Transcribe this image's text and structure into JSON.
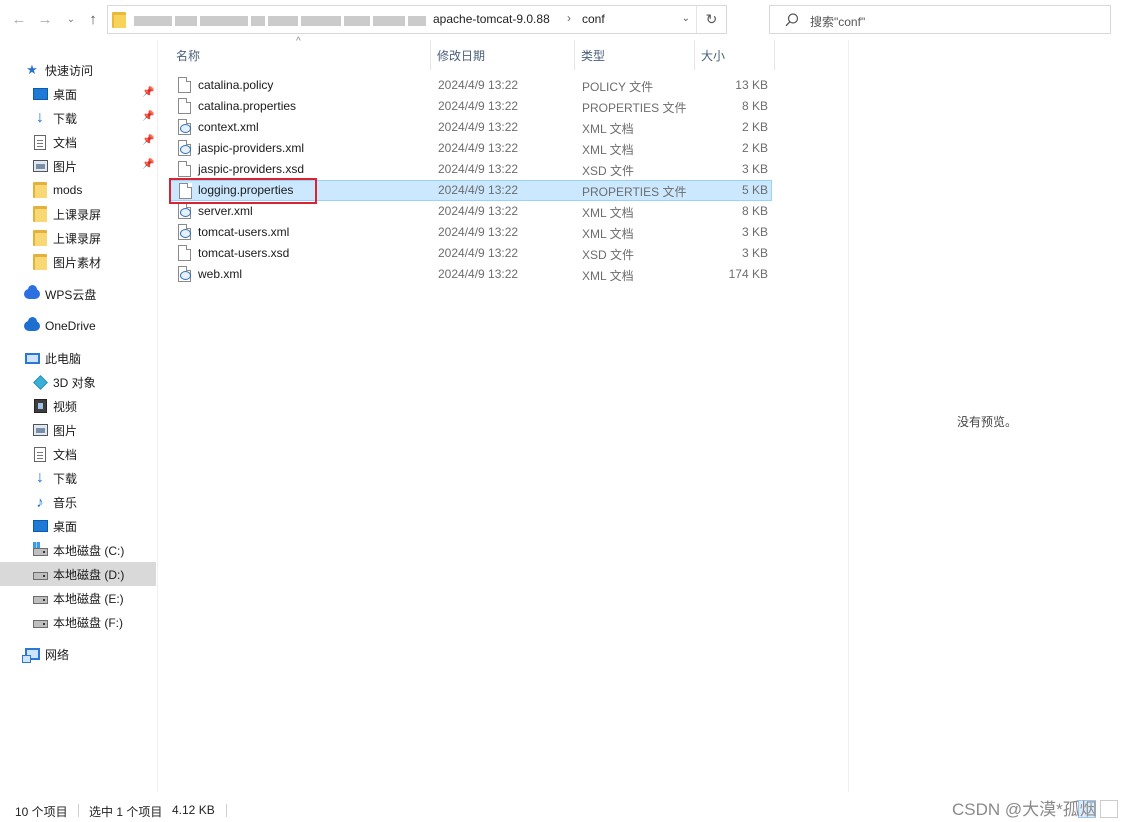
{
  "address_bar": {
    "crumbs": [
      "apache-tomcat-9.0.88",
      "conf"
    ]
  },
  "search": {
    "placeholder": "搜索\"conf\""
  },
  "sidebar": {
    "items": [
      {
        "label": "快速访问",
        "icon": "star-icon"
      },
      {
        "label": "桌面",
        "icon": "desktop-icon",
        "pinned": true
      },
      {
        "label": "下载",
        "icon": "download-icon",
        "pinned": true
      },
      {
        "label": "文档",
        "icon": "document-icon",
        "pinned": true
      },
      {
        "label": "图片",
        "icon": "pictures-icon",
        "pinned": true
      },
      {
        "label": "mods",
        "icon": "folder-icon"
      },
      {
        "label": "上课录屏",
        "icon": "folder-icon"
      },
      {
        "label": "上课录屏",
        "icon": "folder-icon"
      },
      {
        "label": "图片素材",
        "icon": "folder-icon"
      },
      {
        "label": "WPS云盘",
        "icon": "wps-cloud-icon"
      },
      {
        "label": "OneDrive",
        "icon": "onedrive-icon"
      },
      {
        "label": "此电脑",
        "icon": "this-pc-icon"
      },
      {
        "label": "3D 对象",
        "icon": "3d-objects-icon"
      },
      {
        "label": "视频",
        "icon": "video-icon"
      },
      {
        "label": "图片",
        "icon": "pictures-icon"
      },
      {
        "label": "文档",
        "icon": "document-icon"
      },
      {
        "label": "下载",
        "icon": "download-icon"
      },
      {
        "label": "音乐",
        "icon": "music-icon"
      },
      {
        "label": "桌面",
        "icon": "desktop-icon"
      },
      {
        "label": "本地磁盘 (C:)",
        "icon": "system-drive-icon"
      },
      {
        "label": "本地磁盘 (D:)",
        "icon": "drive-icon",
        "selected": true
      },
      {
        "label": "本地磁盘 (E:)",
        "icon": "drive-icon"
      },
      {
        "label": "本地磁盘 (F:)",
        "icon": "drive-icon"
      },
      {
        "label": "网络",
        "icon": "network-icon"
      }
    ]
  },
  "columns": {
    "name": "名称",
    "date": "修改日期",
    "type": "类型",
    "size": "大小"
  },
  "files": [
    {
      "name": "catalina.policy",
      "date": "2024/4/9 13:22",
      "type": "POLICY 文件",
      "size": "13 KB",
      "icon": "file-icon"
    },
    {
      "name": "catalina.properties",
      "date": "2024/4/9 13:22",
      "type": "PROPERTIES 文件",
      "size": "8 KB",
      "icon": "file-icon"
    },
    {
      "name": "context.xml",
      "date": "2024/4/9 13:22",
      "type": "XML 文档",
      "size": "2 KB",
      "icon": "xml-file-icon"
    },
    {
      "name": "jaspic-providers.xml",
      "date": "2024/4/9 13:22",
      "type": "XML 文档",
      "size": "2 KB",
      "icon": "xml-file-icon"
    },
    {
      "name": "jaspic-providers.xsd",
      "date": "2024/4/9 13:22",
      "type": "XSD 文件",
      "size": "3 KB",
      "icon": "file-icon"
    },
    {
      "name": "logging.properties",
      "date": "2024/4/9 13:22",
      "type": "PROPERTIES 文件",
      "size": "5 KB",
      "icon": "file-icon",
      "selected": true
    },
    {
      "name": "server.xml",
      "date": "2024/4/9 13:22",
      "type": "XML 文档",
      "size": "8 KB",
      "icon": "xml-file-icon"
    },
    {
      "name": "tomcat-users.xml",
      "date": "2024/4/9 13:22",
      "type": "XML 文档",
      "size": "3 KB",
      "icon": "xml-file-icon"
    },
    {
      "name": "tomcat-users.xsd",
      "date": "2024/4/9 13:22",
      "type": "XSD 文件",
      "size": "3 KB",
      "icon": "file-icon"
    },
    {
      "name": "web.xml",
      "date": "2024/4/9 13:22",
      "type": "XML 文档",
      "size": "174 KB",
      "icon": "xml-file-icon"
    }
  ],
  "preview": {
    "text": "没有预览。"
  },
  "status": {
    "count": "10 个项目",
    "selection": "选中 1 个项目",
    "selection_size": "4.12 KB"
  },
  "watermark": "CSDN @大漠*孤烟",
  "colors": {
    "selection": "#cce8ff",
    "highlight_box": "#d9232e",
    "accent": "#1e73d1"
  }
}
